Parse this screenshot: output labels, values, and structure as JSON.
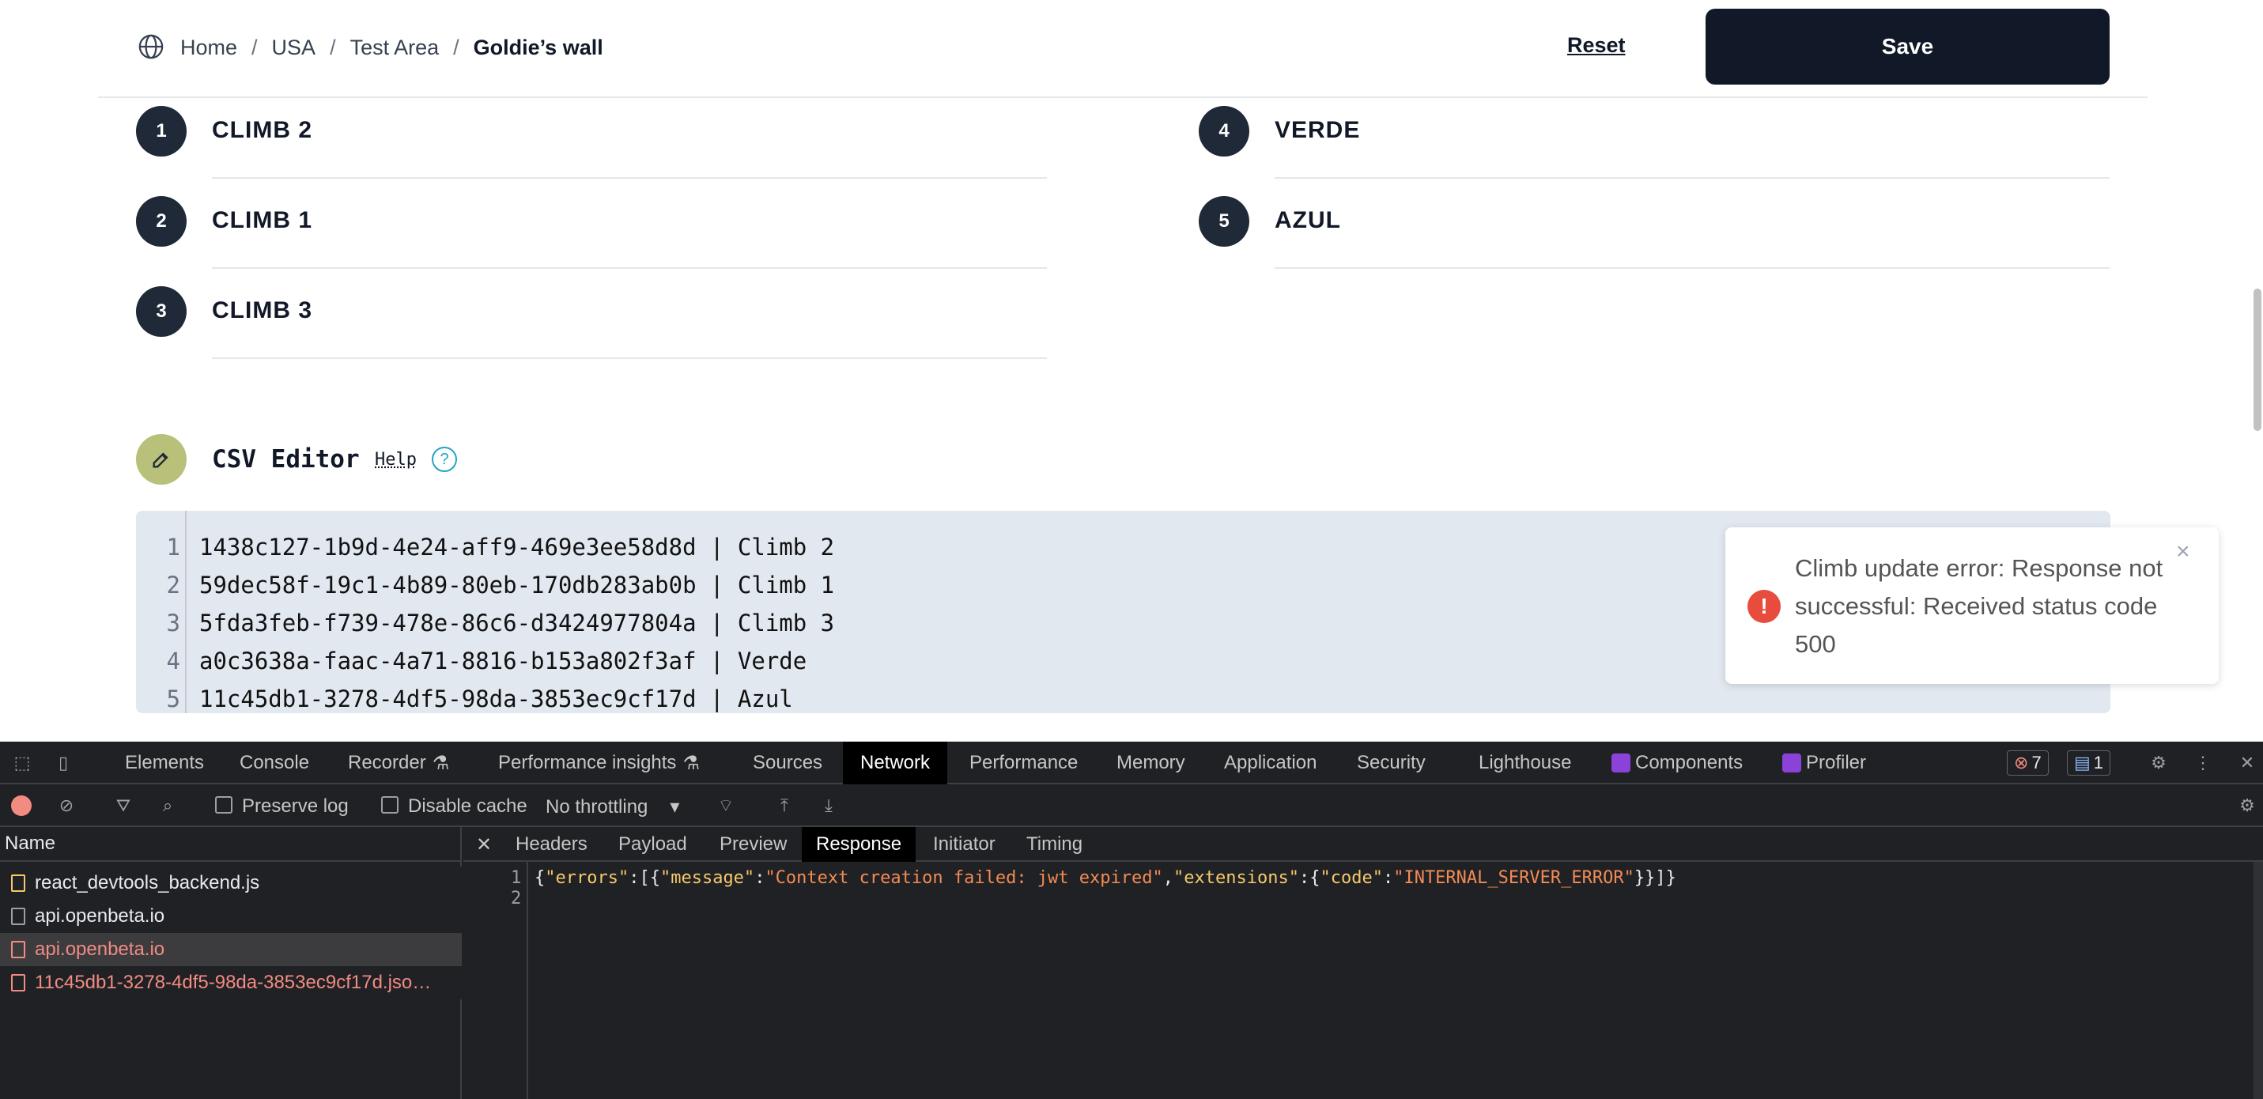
{
  "breadcrumb": {
    "items": [
      "Home",
      "USA",
      "Test Area"
    ],
    "separator": "/",
    "current": "Goldie’s wall"
  },
  "actions": {
    "reset_label": "Reset",
    "save_label": "Save"
  },
  "climbs": [
    {
      "number": "1",
      "name": "CLIMB 2"
    },
    {
      "number": "2",
      "name": "CLIMB 1"
    },
    {
      "number": "3",
      "name": "CLIMB 3"
    },
    {
      "number": "4",
      "name": "VERDE"
    },
    {
      "number": "5",
      "name": "AZUL"
    }
  ],
  "csv_editor": {
    "title": "CSV Editor",
    "help_label": "Help",
    "help_icon": "?",
    "lines": [
      {
        "num": "1",
        "text": "1438c127-1b9d-4e24-aff9-469e3ee58d8d | Climb 2"
      },
      {
        "num": "2",
        "text": "59dec58f-19c1-4b89-80eb-170db283ab0b | Climb 1"
      },
      {
        "num": "3",
        "text": "5fda3feb-f739-478e-86c6-d3424977804a | Climb 3"
      },
      {
        "num": "4",
        "text": "a0c3638a-faac-4a71-8816-b153a802f3af | Verde"
      },
      {
        "num": "5",
        "text": "11c45db1-3278-4df5-98da-3853ec9cf17d | Azul"
      }
    ]
  },
  "toast": {
    "message": "Climb update error: Response not successful: Received status code 500",
    "close_glyph": "×",
    "icon_glyph": "!",
    "error_color": "#e74c3c"
  },
  "devtools": {
    "tabs": [
      "Elements",
      "Console",
      "Recorder",
      "Performance insights",
      "Sources",
      "Network",
      "Performance",
      "Memory",
      "Application",
      "Security",
      "Lighthouse",
      "Components",
      "Profiler"
    ],
    "active_tab": "Network",
    "error_count": "7",
    "message_count": "1",
    "toolbar": {
      "preserve_log": "Preserve log",
      "disable_cache": "Disable cache",
      "throttling": "No throttling"
    },
    "name_header": "Name",
    "requests": [
      {
        "name": "react_devtools_backend.js",
        "error": false
      },
      {
        "name": "api.openbeta.io",
        "error": false
      },
      {
        "name": "api.openbeta.io",
        "error": true
      },
      {
        "name": "11c45db1-3278-4df5-98da-3853ec9cf17d.jso…",
        "error": true
      }
    ],
    "detail_tabs": [
      "Headers",
      "Payload",
      "Preview",
      "Response",
      "Initiator",
      "Timing"
    ],
    "active_detail_tab": "Response",
    "response": {
      "line_numbers": [
        "1",
        "2"
      ],
      "tokens": [
        {
          "t": "{",
          "c": "p"
        },
        {
          "t": "\"errors\"",
          "c": "k"
        },
        {
          "t": ":[{",
          "c": "p"
        },
        {
          "t": "\"message\"",
          "c": "k"
        },
        {
          "t": ":",
          "c": "p"
        },
        {
          "t": "\"Context creation failed: jwt expired\"",
          "c": "s"
        },
        {
          "t": ",",
          "c": "p"
        },
        {
          "t": "\"extensions\"",
          "c": "k"
        },
        {
          "t": ":{",
          "c": "p"
        },
        {
          "t": "\"code\"",
          "c": "k"
        },
        {
          "t": ":",
          "c": "p"
        },
        {
          "t": "\"INTERNAL_SERVER_ERROR\"",
          "c": "s"
        },
        {
          "t": "}}]}",
          "c": "p"
        }
      ]
    }
  }
}
